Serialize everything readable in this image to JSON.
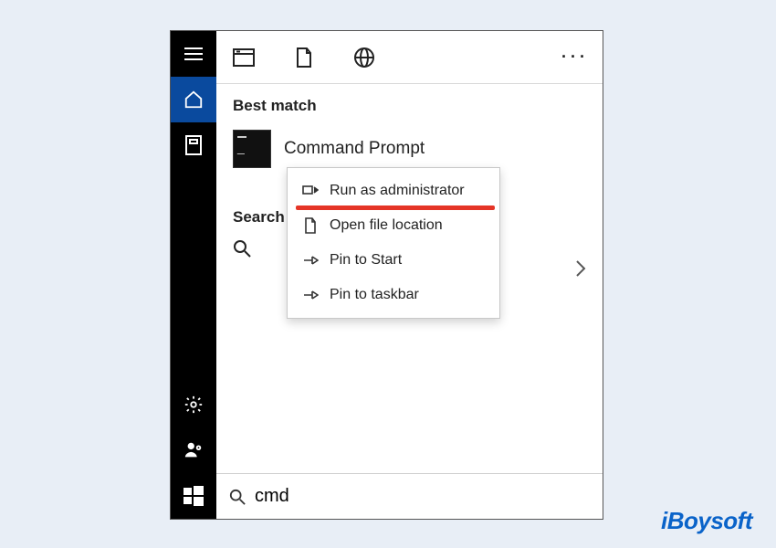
{
  "section_best_match": "Best match",
  "result_title": "Command Prompt",
  "section_search": "Search",
  "context_menu": {
    "run_admin": "Run as administrator",
    "open_loc": "Open file location",
    "pin_start": "Pin to Start",
    "pin_taskbar": "Pin to taskbar"
  },
  "search_query": "cmd",
  "watermark": "iBoysoft"
}
